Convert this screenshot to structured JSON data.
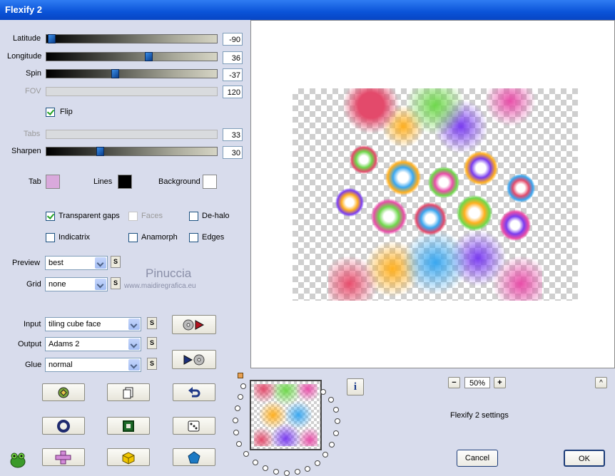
{
  "window": {
    "title": "Flexify 2"
  },
  "sliders": [
    {
      "label": "Latitude",
      "value": "-90",
      "level": 0.02
    },
    {
      "label": "Longitude",
      "value": "36",
      "level": 0.6
    },
    {
      "label": "Spin",
      "value": "-37",
      "level": 0.4
    },
    {
      "label": "FOV",
      "value": "120",
      "level": null
    },
    {
      "label": "Tabs",
      "value": "33",
      "level": null
    },
    {
      "label": "Sharpen",
      "value": "30",
      "level": 0.31
    }
  ],
  "flip": {
    "label": "Flip",
    "checked": true
  },
  "colors": {
    "tab": {
      "label": "Tab",
      "color": "#d9a9dc"
    },
    "lines": {
      "label": "Lines",
      "color": "#000000"
    },
    "background": {
      "label": "Background",
      "color": "#ffffff"
    }
  },
  "options": [
    {
      "label": "Transparent gaps",
      "checked": true,
      "enabled": true
    },
    {
      "label": "Faces",
      "checked": false,
      "enabled": false
    },
    {
      "label": "De-halo",
      "checked": false,
      "enabled": true
    },
    {
      "label": "Indicatrix",
      "checked": false,
      "enabled": true
    },
    {
      "label": "Anamorph",
      "checked": false,
      "enabled": true
    },
    {
      "label": "Edges",
      "checked": false,
      "enabled": true
    }
  ],
  "dropdowns": {
    "preview": {
      "label": "Preview",
      "value": "best"
    },
    "grid": {
      "label": "Grid",
      "value": "none"
    },
    "input": {
      "label": "Input",
      "value": "tiling cube face"
    },
    "output": {
      "label": "Output",
      "value": "Adams 2"
    },
    "glue": {
      "label": "Glue",
      "value": "normal"
    }
  },
  "s_label": "S",
  "watermark": {
    "name": "Pinuccia",
    "site": "www.maidiregrafica.eu"
  },
  "zoom": {
    "value": "50%",
    "minus": "−",
    "plus": "+"
  },
  "settings_name": "Flexify 2 settings",
  "buttons": {
    "cancel": "Cancel",
    "ok": "OK",
    "info": "i",
    "collapse": "^"
  },
  "icons": {
    "play_to_preview": "play-disk-icon",
    "preview_from_play": "disk-play-icon",
    "row1": [
      "randomize-icon",
      "copy-icon",
      "undo-icon"
    ],
    "row2": [
      "circle-icon",
      "square-icon",
      "dice-icon"
    ],
    "row3": [
      "cross-icon",
      "cube-icon",
      "pentagon-icon"
    ]
  }
}
